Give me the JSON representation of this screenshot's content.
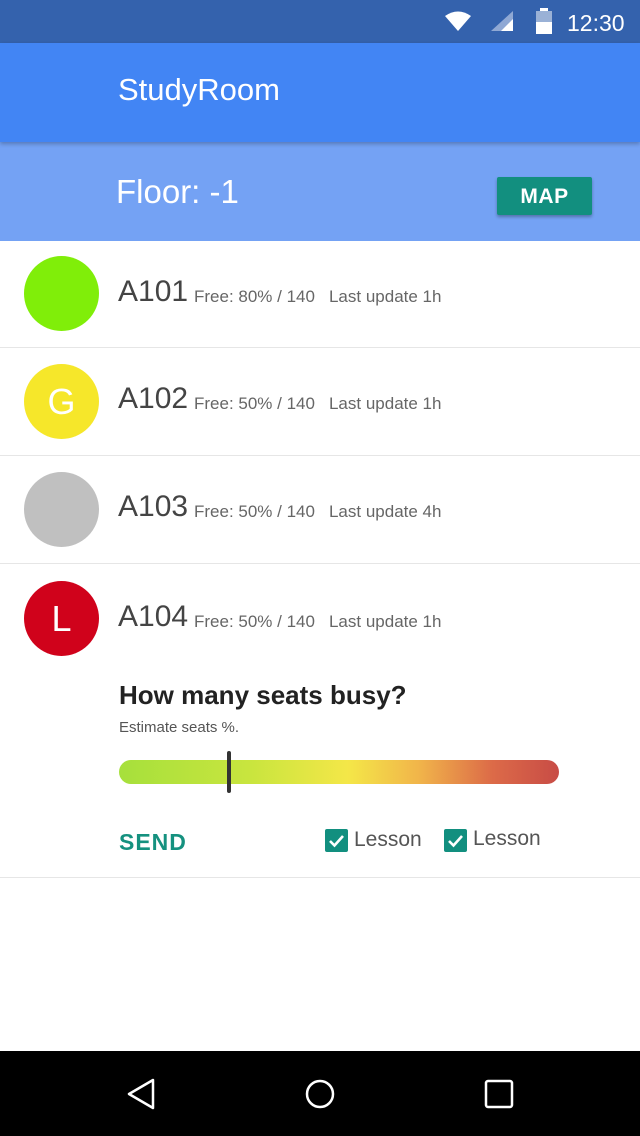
{
  "status_bar": {
    "time": "12:30",
    "icons": [
      "wifi-icon",
      "cell-signal-icon",
      "battery-icon"
    ]
  },
  "app_bar": {
    "title": "StudyRoom"
  },
  "floor_bar": {
    "label": "Floor: -1",
    "map_button": "MAP"
  },
  "rooms": [
    {
      "name": "A101",
      "free": "Free: 80% / 140",
      "update": "Last update 1h",
      "avatar_letter": "",
      "avatar_color": "#80ee09"
    },
    {
      "name": "A102",
      "free": "Free: 50% / 140",
      "update": "Last update 1h",
      "avatar_letter": "G",
      "avatar_color": "#f6e72a"
    },
    {
      "name": "A103",
      "free": "Free: 50% / 140",
      "update": "Last update 4h",
      "avatar_letter": "",
      "avatar_color": "#c0c0c0"
    },
    {
      "name": "A104",
      "free": "Free: 50% / 140",
      "update": "Last update 1h",
      "avatar_letter": "L",
      "avatar_color": "#d0021b"
    }
  ],
  "feedback": {
    "question": "How many seats busy?",
    "hint": "Estimate seats %.",
    "slider_value_fraction": 0.25,
    "send_label": "SEND",
    "checkboxes": [
      {
        "label": "Lesson",
        "checked": true
      },
      {
        "label": "Lesson",
        "checked": true
      }
    ]
  },
  "colors": {
    "status_bar": "#3462ad",
    "app_bar": "#4285f4",
    "floor_bar": "#74a2f4",
    "accent": "#128f7f"
  },
  "nav_bar": {
    "icons": [
      "back-icon",
      "home-icon",
      "recents-icon"
    ]
  }
}
